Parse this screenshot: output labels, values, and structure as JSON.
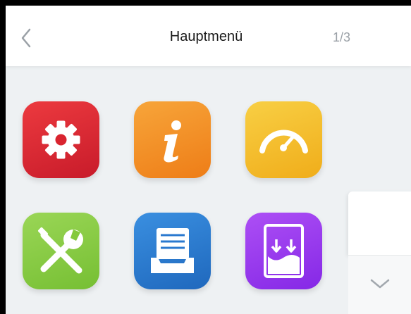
{
  "header": {
    "title": "Hauptmenü",
    "page_indicator": "1/3",
    "back_icon": "chevron-left-icon"
  },
  "tiles": [
    {
      "name": "settings",
      "icon": "gear-icon",
      "color": "#e02430"
    },
    {
      "name": "info",
      "icon": "info-icon",
      "color": "#f39320"
    },
    {
      "name": "speed",
      "icon": "gauge-icon",
      "color": "#f6c12e"
    },
    {
      "name": "tools",
      "icon": "wrench-screwdriver-icon",
      "color": "#8bcf44"
    },
    {
      "name": "archive",
      "icon": "inbox-tray-icon",
      "color": "#2f7fd2"
    },
    {
      "name": "level",
      "icon": "level-download-icon",
      "color": "#9b3cf0"
    }
  ],
  "side_panel": {
    "scroll_icon": "chevron-down-icon"
  }
}
